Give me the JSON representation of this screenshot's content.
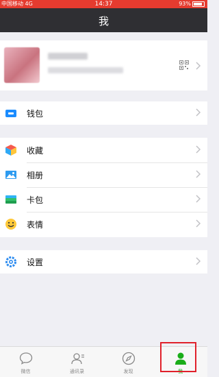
{
  "status_bar": {
    "carrier": "中国移动 4G",
    "time": "14:37",
    "battery": "93%"
  },
  "nav": {
    "title": "我"
  },
  "profile": {
    "avatar": "blurred-avatar"
  },
  "menu": {
    "wallet": "钱包",
    "favorites": "收藏",
    "album": "相册",
    "card": "卡包",
    "sticker": "表情",
    "settings": "设置"
  },
  "tabs": [
    {
      "label": "微信",
      "icon": "chat-icon"
    },
    {
      "label": "通讯录",
      "icon": "contacts-icon"
    },
    {
      "label": "发现",
      "icon": "discover-icon"
    },
    {
      "label": "我",
      "icon": "me-icon"
    }
  ],
  "colors": {
    "status": "#e53b2f",
    "nav": "#2f2f33",
    "accent": "#1aad19",
    "highlight": "#e0202a"
  }
}
